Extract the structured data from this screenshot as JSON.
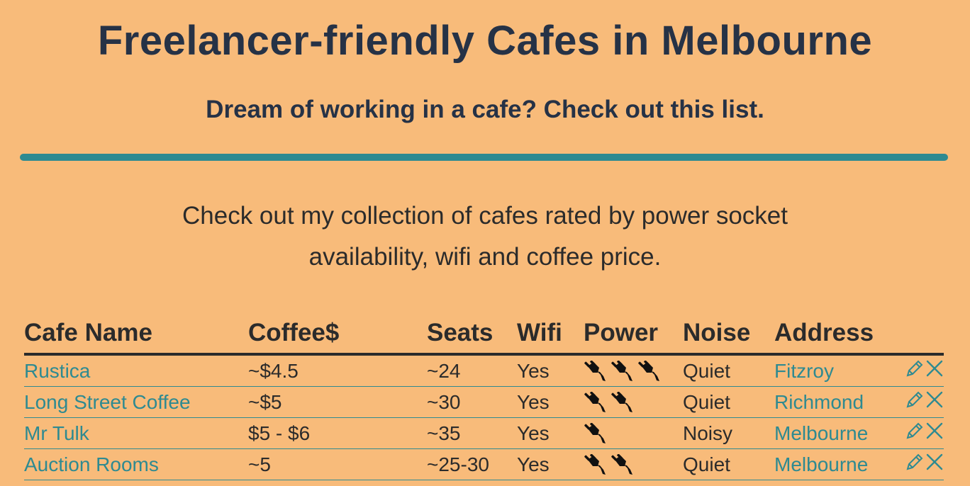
{
  "header": {
    "title": "Freelancer-friendly Cafes in Melbourne",
    "subtitle": "Dream of working in a cafe? Check out this list."
  },
  "intro": {
    "text": "Check out my collection of cafes rated by power socket availability, wifi and coffee price."
  },
  "colors": {
    "background": "#F8BB7A",
    "heading": "#263246",
    "accent": "#2E8A91",
    "text": "#2B2B2B"
  },
  "table": {
    "columns": [
      "Cafe Name",
      "Coffee$",
      "Seats",
      "Wifi",
      "Power",
      "Noise",
      "Address"
    ],
    "rows": [
      {
        "name": "Rustica",
        "coffee": "~$4.5",
        "seats": "~24",
        "wifi": "Yes",
        "power": 3,
        "noise": "Quiet",
        "address": "Fitzroy"
      },
      {
        "name": "Long Street Coffee",
        "coffee": "~$5",
        "seats": "~30",
        "wifi": "Yes",
        "power": 2,
        "noise": "Quiet",
        "address": "Richmond"
      },
      {
        "name": "Mr Tulk",
        "coffee": "$5 - $6",
        "seats": "~35",
        "wifi": "Yes",
        "power": 1,
        "noise": "Noisy",
        "address": "Melbourne"
      },
      {
        "name": "Auction Rooms",
        "coffee": "~5",
        "seats": "~25-30",
        "wifi": "Yes",
        "power": 2,
        "noise": "Quiet",
        "address": "Melbourne"
      }
    ],
    "icons": {
      "power": "power-plug-icon",
      "edit": "pencil-icon",
      "delete": "close-icon"
    }
  }
}
